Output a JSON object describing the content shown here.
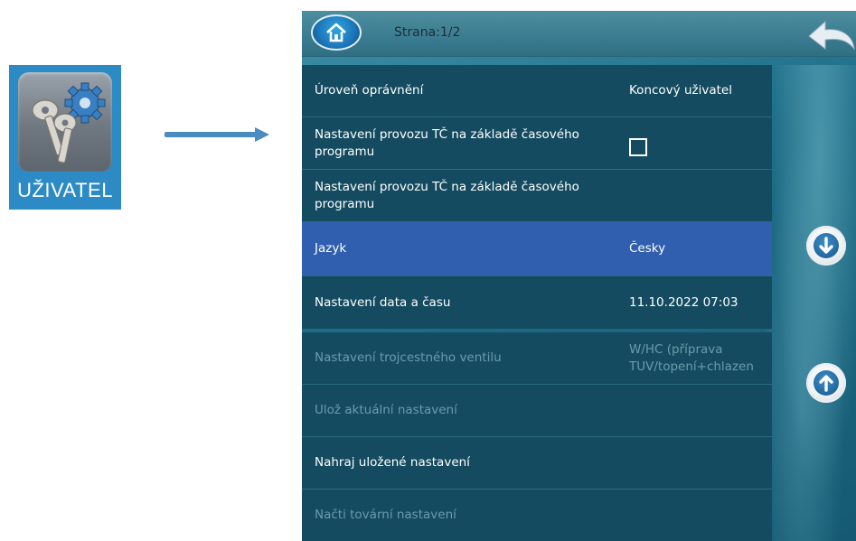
{
  "app_icon": {
    "label": "UŽIVATEL",
    "icon": "keys-gear-icon",
    "background": "#2c8bc4"
  },
  "screen": {
    "page_indicator": "Strana:1/2",
    "home_icon": "home-icon",
    "back_icon": "back-arrow-icon",
    "scroll_down_icon": "arrow-down-icon",
    "scroll_up_icon": "arrow-up-icon",
    "rows": [
      {
        "label": "Úroveň oprávnění",
        "value": "Koncový uživatel"
      },
      {
        "label": "Nastavení provozu TČ na základě časového programu",
        "value": "",
        "checkbox": false
      },
      {
        "label": "Nastavení provozu TČ na základě časového programu",
        "value": ""
      },
      {
        "label": "Jazyk",
        "value": "Česky",
        "selected": true
      },
      {
        "label": "Nastavení data a času",
        "value": "11.10.2022 07:03"
      },
      {
        "label": "Nastavení trojcestného ventilu",
        "value": "W/HC (příprava TUV/topení+chlazen",
        "disabled": true
      },
      {
        "label": "Ulož aktuální nastavení",
        "value": "",
        "disabled": true
      },
      {
        "label": "Nahraj uložené nastavení",
        "value": ""
      },
      {
        "label": "Načti tovární nastavení",
        "value": "",
        "disabled": true
      }
    ],
    "colors": {
      "panel": "#144b60",
      "selected_row": "#2f5fae",
      "disabled_text": "#6b9cad"
    }
  }
}
